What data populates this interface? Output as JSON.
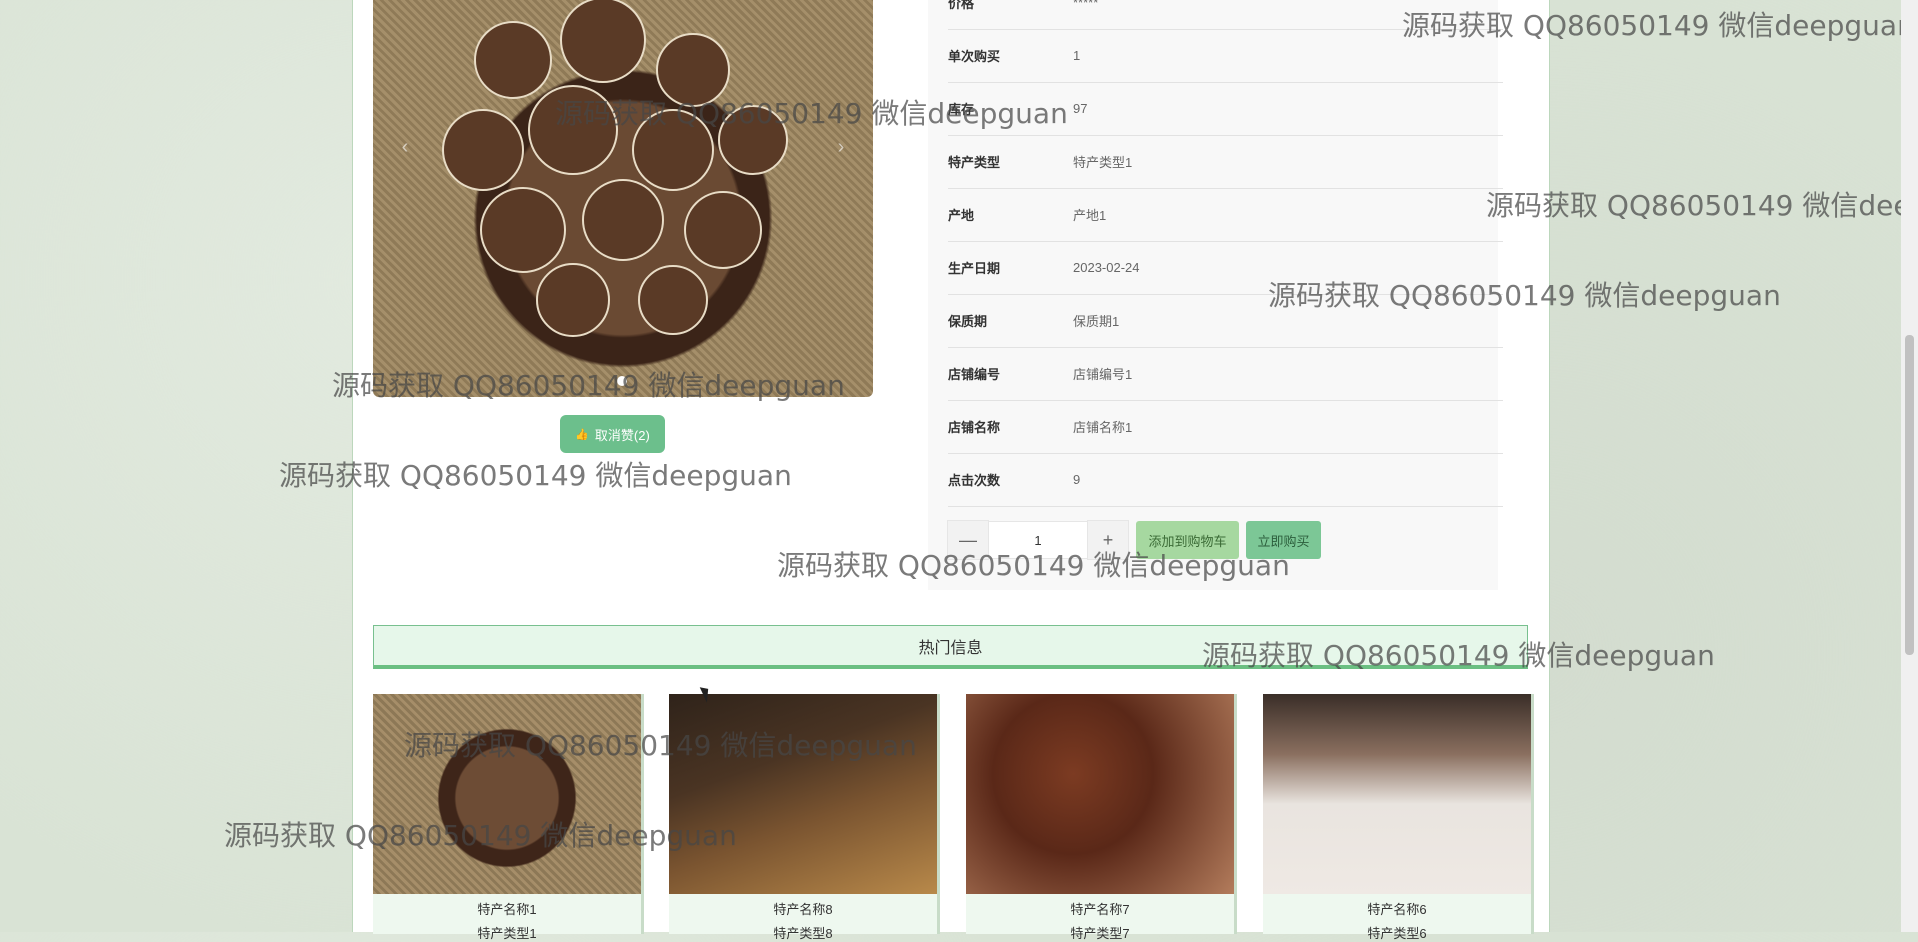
{
  "carousel": {
    "prev_label": "‹",
    "next_label": "›",
    "unlike_label": "取消赞(2)"
  },
  "details": [
    {
      "label": "价格",
      "value": "*****"
    },
    {
      "label": "单次购买",
      "value": "1"
    },
    {
      "label": "库存",
      "value": "97"
    },
    {
      "label": "特产类型",
      "value": "特产类型1"
    },
    {
      "label": "产地",
      "value": "产地1"
    },
    {
      "label": "生产日期",
      "value": "2023-02-24"
    },
    {
      "label": "保质期",
      "value": "保质期1"
    },
    {
      "label": "店铺编号",
      "value": "店铺编号1"
    },
    {
      "label": "店铺名称",
      "value": "店铺名称1"
    },
    {
      "label": "点击次数",
      "value": "9"
    }
  ],
  "purchase": {
    "minus_label": "—",
    "plus_label": "+",
    "quantity": "1",
    "add_cart_label": "添加到购物车",
    "buy_now_label": "立即购买"
  },
  "hot": {
    "title": "热门信息",
    "items": [
      {
        "name": "特产名称1",
        "type": "特产类型1"
      },
      {
        "name": "特产名称8",
        "type": "特产类型8"
      },
      {
        "name": "特产名称7",
        "type": "特产类型7"
      },
      {
        "name": "特产名称6",
        "type": "特产类型6"
      }
    ]
  },
  "watermark": "源码获取 QQ86050149 微信deepguan"
}
